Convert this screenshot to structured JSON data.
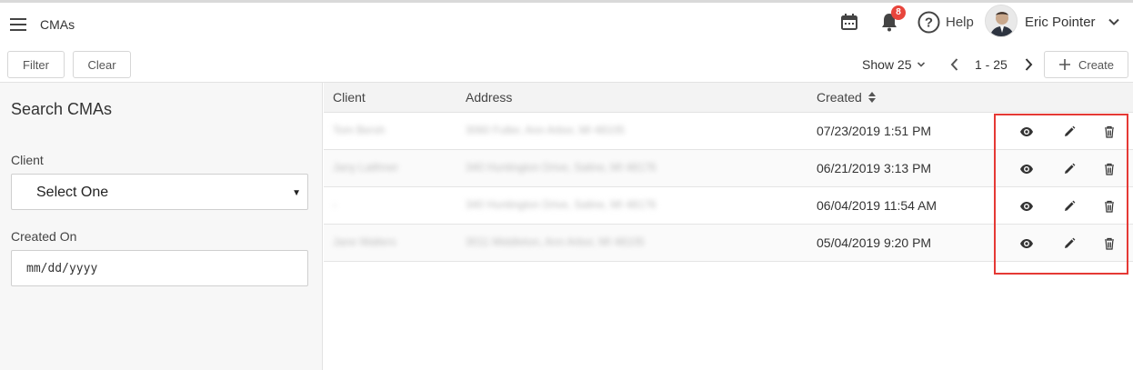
{
  "header": {
    "app_title": "CMAs",
    "notification_count": "8",
    "help_label": "Help",
    "user_name": "Eric Pointer"
  },
  "toolbar": {
    "filter_label": "Filter",
    "clear_label": "Clear",
    "show_label": "Show 25",
    "pager_range": "1 - 25",
    "create_label": "Create"
  },
  "search": {
    "title": "Search CMAs",
    "client_label": "Client",
    "client_selected": "Select One",
    "created_on_label": "Created On",
    "created_on_placeholder": "mm/dd/yyyy"
  },
  "table": {
    "columns": [
      "Client",
      "Address",
      "Created"
    ],
    "rows": [
      {
        "client": "Tom Bersh",
        "address": "3060 Fuller, Ann Arbor, MI 48105",
        "created": "07/23/2019 1:51 PM"
      },
      {
        "client": "Jany Laithner",
        "address": "340 Huntington Drive, Saline, MI 48176",
        "created": "06/21/2019 3:13 PM"
      },
      {
        "client": "-",
        "address": "340 Huntington Drive, Saline, MI 48176",
        "created": "06/04/2019 11:54 AM"
      },
      {
        "client": "Jane Walters",
        "address": "3011 Middleton, Ann Arbor, MI 48105",
        "created": "05/04/2019 9:20 PM"
      }
    ]
  },
  "colors": {
    "badge": "#e8453c",
    "highlight": "#e53935",
    "action_icon": "#333333"
  },
  "icons": [
    "menu-icon",
    "calendar-icon",
    "bell-icon",
    "help-icon",
    "chevron-down-icon",
    "chevron-left-icon",
    "chevron-right-icon",
    "plus-icon",
    "sort-icon",
    "eye-icon",
    "pencil-icon",
    "trash-icon"
  ]
}
